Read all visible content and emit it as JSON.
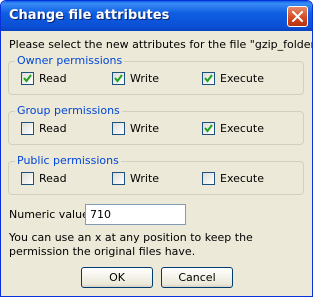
{
  "window": {
    "title": "Change file attributes"
  },
  "prompt": "Please select the new attributes for the file \"gzip_folders.sh\":",
  "groups": [
    {
      "title": "Owner permissions",
      "options": [
        {
          "label": "Read",
          "checked": true
        },
        {
          "label": "Write",
          "checked": true
        },
        {
          "label": "Execute",
          "checked": true
        }
      ]
    },
    {
      "title": "Group permissions",
      "options": [
        {
          "label": "Read",
          "checked": false
        },
        {
          "label": "Write",
          "checked": false
        },
        {
          "label": "Execute",
          "checked": true
        }
      ]
    },
    {
      "title": "Public permissions",
      "options": [
        {
          "label": "Read",
          "checked": false
        },
        {
          "label": "Write",
          "checked": false
        },
        {
          "label": "Execute",
          "checked": false
        }
      ]
    }
  ],
  "numeric": {
    "label": "Numeric value:",
    "value": "710"
  },
  "note": "You can use an x at any position to keep the permission the original files have.",
  "buttons": {
    "ok": "OK",
    "cancel": "Cancel"
  },
  "colors": {
    "group_title": "#0046d5",
    "titlebar": "#0b4fd6",
    "checkmark": "#21a121"
  },
  "icons": {
    "close": "close-icon",
    "check": "checkmark-icon"
  }
}
